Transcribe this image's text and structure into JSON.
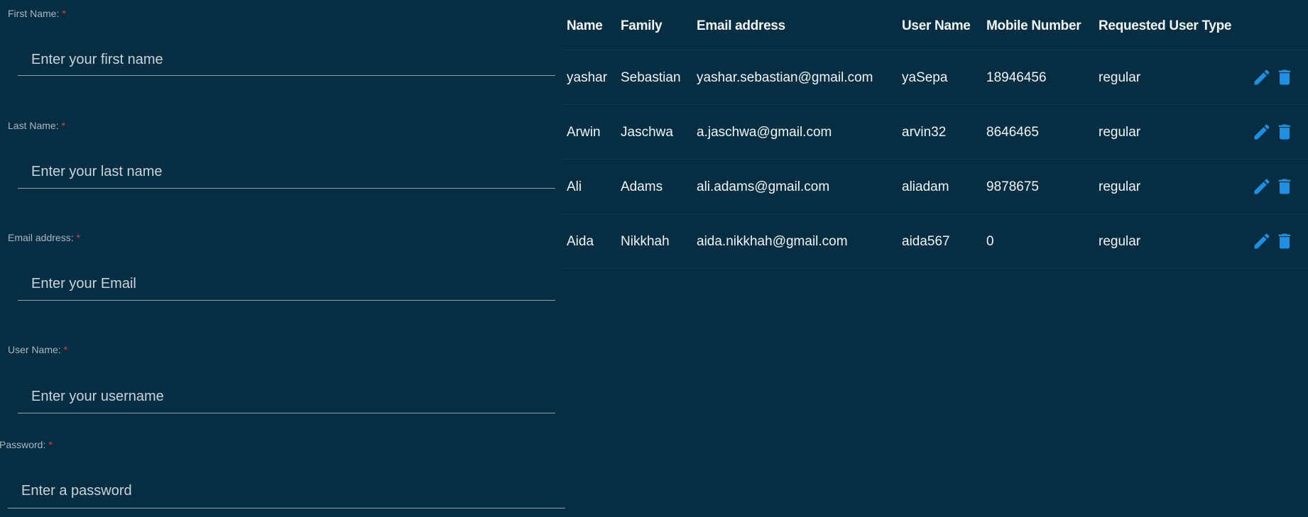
{
  "form": {
    "fields": [
      {
        "label": "First Name:",
        "required_mark": "*",
        "placeholder": "Enter your first name"
      },
      {
        "label": "Last Name:",
        "required_mark": "*",
        "placeholder": "Enter your last name"
      },
      {
        "label": "Email address:",
        "required_mark": "*",
        "placeholder": "Enter your Email"
      },
      {
        "label": "User Name:",
        "required_mark": "*",
        "placeholder": "Enter your username"
      },
      {
        "label": "Password:",
        "required_mark": "*",
        "placeholder": "Enter a password"
      }
    ]
  },
  "table": {
    "headers": {
      "name": "Name",
      "family": "Family",
      "email": "Email address",
      "username": "User Name",
      "mobile": "Mobile Number",
      "type": "Requested User Type"
    },
    "rows": [
      {
        "name": "yashar",
        "family": "Sebastian",
        "email": "yashar.sebastian@gmail.com",
        "username": "yaSepa",
        "mobile": "18946456",
        "type": "regular"
      },
      {
        "name": "Arwin",
        "family": "Jaschwa",
        "email": "a.jaschwa@gmail.com",
        "username": "arvin32",
        "mobile": "8646465",
        "type": "regular"
      },
      {
        "name": "Ali",
        "family": "Adams",
        "email": "ali.adams@gmail.com",
        "username": "aliadam",
        "mobile": "9878675",
        "type": "regular"
      },
      {
        "name": "Aida",
        "family": "Nikkhah",
        "email": "aida.nikkhah@gmail.com",
        "username": "aida567",
        "mobile": "0",
        "type": "regular"
      }
    ],
    "row_actions": {
      "edit_icon": "pencil-icon",
      "delete_icon": "trash-icon"
    }
  },
  "colors": {
    "background": "#062e43",
    "accent": "#1e8fe1",
    "required": "#e5423a"
  }
}
